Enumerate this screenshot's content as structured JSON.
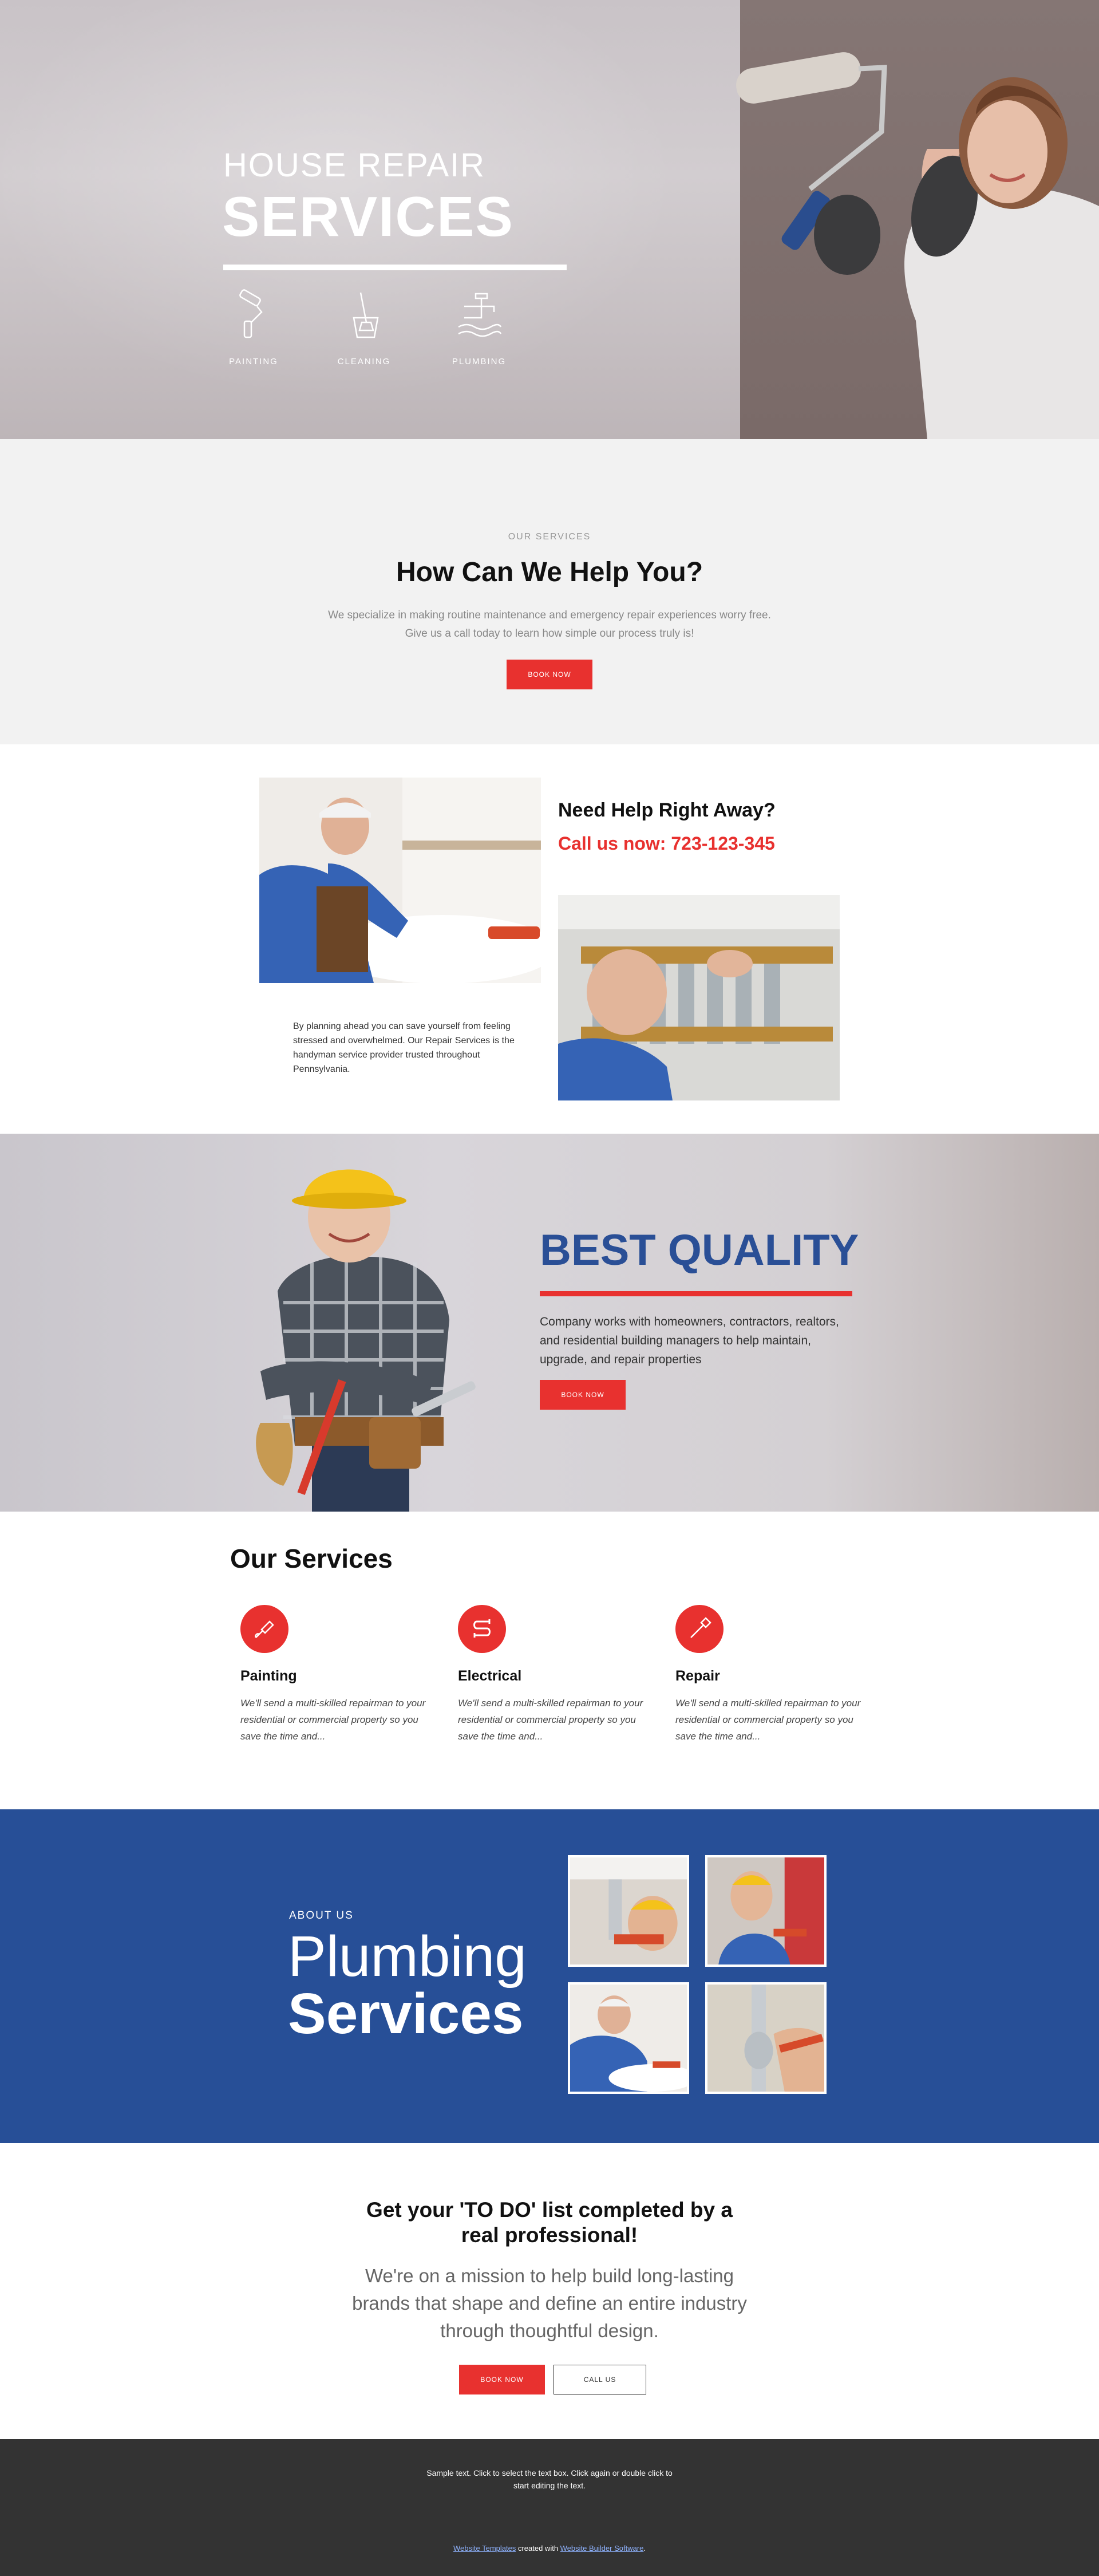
{
  "hero": {
    "title_small": "HOUSE REPAIR",
    "title_large": "SERVICES",
    "services": [
      {
        "label": "PAINTING",
        "icon": "paint-roller-icon"
      },
      {
        "label": "CLEANING",
        "icon": "mop-bucket-icon"
      },
      {
        "label": "PLUMBING",
        "icon": "faucet-icon"
      }
    ]
  },
  "help": {
    "kicker": "OUR SERVICES",
    "title": "How Can We Help You?",
    "text": "We specialize in making routine maintenance and emergency repair experiences worry free. Give us a call today to learn how simple our process truly is!",
    "button": "BOOK NOW"
  },
  "need": {
    "title": "Need Help Right Away?",
    "call": "Call us now: 723-123-345",
    "text": "By planning ahead you can save yourself from feeling stressed and overwhelmed. Our Repair Services is the handyman service provider trusted throughout Pennsylvania."
  },
  "quality": {
    "title": "BEST QUALITY",
    "text": "Company works with homeowners, contractors, realtors, and residential building managers to help maintain, upgrade, and repair properties",
    "button": "BOOK NOW"
  },
  "services": {
    "title": "Our Services",
    "items": [
      {
        "name": "Painting",
        "icon": "brush-icon",
        "text": "We'll send a multi-skilled repairman to your residential or commercial property so you save the time and..."
      },
      {
        "name": "Electrical",
        "icon": "electrical-icon",
        "text": "We'll send a multi-skilled repairman to your residential or commercial property so you save the time and..."
      },
      {
        "name": "Repair",
        "icon": "screwdriver-icon",
        "text": "We'll send a multi-skilled repairman to your residential or commercial property so you save the time and..."
      }
    ]
  },
  "plumbing": {
    "kicker": "ABOUT US",
    "title_light": "Plumbing",
    "title_bold": "Services"
  },
  "todo": {
    "title": "Get your 'TO DO' list completed by a real professional!",
    "text": "We're on a mission to help build long-lasting brands that shape and define an entire industry through thoughtful design.",
    "primary_button": "BOOK NOW",
    "secondary_button": "CALL US"
  },
  "footer": {
    "sample": "Sample text. Click to select the text box. Click again or double click to start editing the text.",
    "link1": "Website Templates",
    "middle": " created with ",
    "link2": "Website Builder Software",
    "end": "."
  },
  "colors": {
    "accent_red": "#e8312f",
    "brand_blue": "#274f97",
    "footer_bg": "#333333"
  }
}
